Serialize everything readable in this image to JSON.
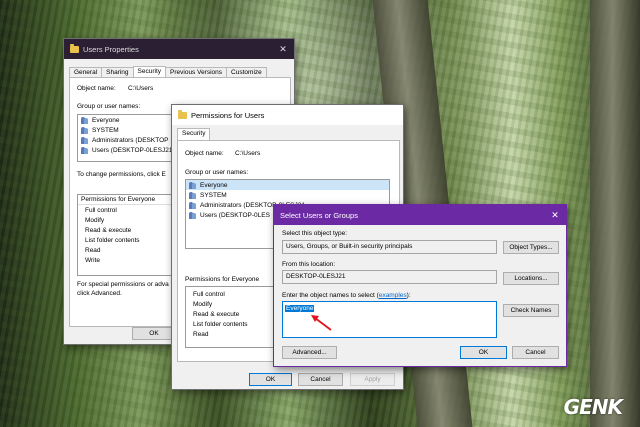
{
  "users_properties": {
    "title": "Users Properties",
    "close": "✕",
    "tabs": [
      "General",
      "Sharing",
      "Security",
      "Previous Versions",
      "Customize"
    ],
    "object_name_label": "Object name:",
    "object_name_value": "C:\\Users",
    "group_label": "Group or user names:",
    "groups": [
      "Everyone",
      "SYSTEM",
      "Administrators (DESKTOP",
      "Users (DESKTOP-0LESJ21"
    ],
    "change_text": "To change permissions, click E",
    "permissions_label": "Permissions for Everyone",
    "permissions": [
      "Full control",
      "Modify",
      "Read & execute",
      "List folder contents",
      "Read",
      "Write"
    ],
    "special_text_1": "For special permissions or adva",
    "special_text_2": "click Advanced.",
    "ok_label": "OK"
  },
  "permissions_for_users": {
    "title": "Permissions for Users",
    "tab": "Security",
    "object_name_label": "Object name:",
    "object_name_value": "C:\\Users",
    "group_label": "Group or user names:",
    "groups": [
      "Everyone",
      "SYSTEM",
      "Administrators (DESKTOP-0LESJ21",
      "Users (DESKTOP-0LES"
    ],
    "permissions_label": "Permissions for Everyone",
    "permissions": [
      "Full control",
      "Modify",
      "Read & execute",
      "List folder contents",
      "Read"
    ],
    "ok_label": "OK",
    "cancel_label": "Cancel",
    "apply_label": "Apply"
  },
  "select_users": {
    "title": "Select Users or Groups",
    "close": "✕",
    "object_type_label": "Select this object type:",
    "object_type_value": "Users, Groups, or Built-in security principals",
    "object_types_button": "Object Types...",
    "location_label": "From this location:",
    "location_value": "DESKTOP-0LESJ21",
    "locations_button": "Locations...",
    "enter_label": "Enter the object names to select (",
    "examples_link": "examples",
    "enter_label_end": "):",
    "entered_value": "Everyone",
    "check_names_button": "Check Names",
    "advanced_button": "Advanced...",
    "ok_label": "OK",
    "cancel_label": "Cancel"
  },
  "watermark": "GENK",
  "colors": {
    "accent_title": "#6b2aa4",
    "selection": "#0078d7",
    "arrow": "#e0141e"
  }
}
